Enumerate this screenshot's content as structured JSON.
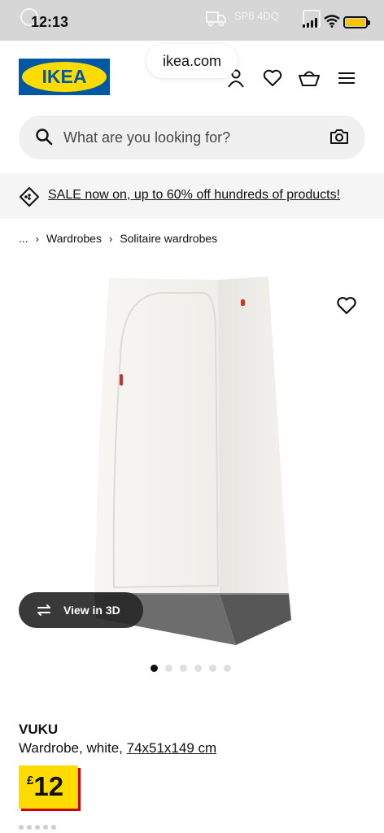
{
  "status_bar": {
    "time": "12:13",
    "background": "#d6d6d6",
    "ghost_postcode": "SP8 4DQ",
    "battery_color": "#f7c600"
  },
  "browser": {
    "url": "ikea.com"
  },
  "header": {
    "logo_text": "IKEA",
    "brand_blue": "#0058a3",
    "brand_yellow": "#ffdb00",
    "icons": [
      "user-icon",
      "heart-icon",
      "basket-icon",
      "menu-icon"
    ]
  },
  "search": {
    "placeholder": "What are you looking for?"
  },
  "banner": {
    "text": "SALE now on, up to 60% off hundreds of products!"
  },
  "breadcrumb": {
    "ellipsis": "...",
    "items": [
      "Wardrobes",
      "Solitaire wardrobes"
    ]
  },
  "gallery": {
    "view_3d_label": "View in 3D",
    "image_count": 6,
    "active_index": 0
  },
  "product": {
    "name": "VUKU",
    "description": "Wardrobe, white,",
    "dimensions": "74x51x149 cm",
    "currency": "£",
    "price": "12",
    "price_shadow": "#cc0008"
  }
}
